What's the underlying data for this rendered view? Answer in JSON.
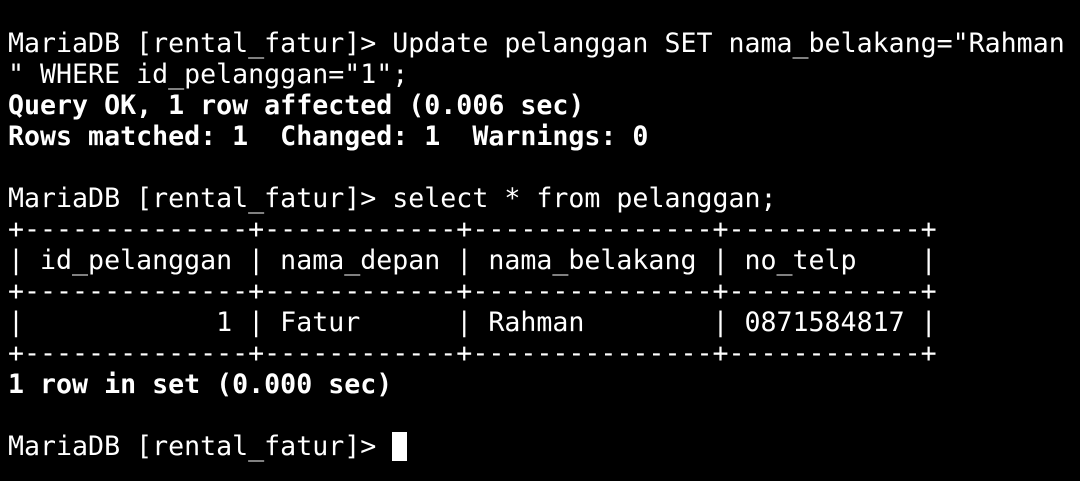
{
  "terminal": {
    "prompt": "MariaDB [rental_fatur]> ",
    "update_cmd_1": "Update pelanggan SET nama_belakang=\"Rahman",
    "update_cmd_2": "\" WHERE id_pelanggan=\"1\";",
    "query_ok": "Query OK, 1 row affected (0.006 sec)",
    "rows_matched": "Rows matched: 1  Changed: 1  Warnings: 0",
    "select_cmd": "select * from pelanggan;",
    "table": {
      "border": "+--------------+------------+---------------+------------+",
      "header": "| id_pelanggan | nama_depan | nama_belakang | no_telp    |",
      "rows": [
        "|            1 | Fatur      | Rahman        | 0871584817 |"
      ]
    },
    "result_summary": "1 row in set (0.000 sec)"
  },
  "colors": {
    "background": "#000000",
    "foreground": "#ffffff"
  }
}
